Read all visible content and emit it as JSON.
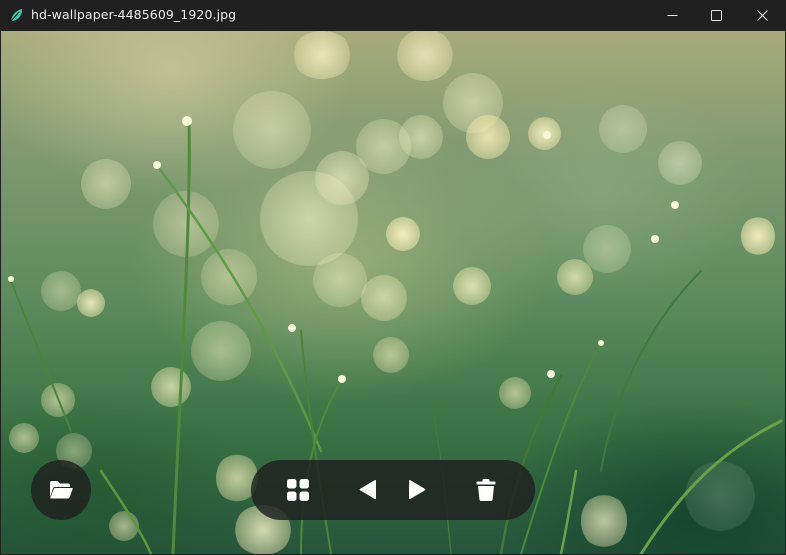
{
  "window": {
    "title": "hd-wallpaper-4485609_1920.jpg",
    "app_icon": "leaf-icon",
    "controls": [
      "minimize-icon",
      "maximize-icon",
      "close-icon"
    ]
  },
  "viewer": {
    "image_description_icon": "photo-icon"
  },
  "toolbar": {
    "open_icon": "folder-open-icon",
    "buttons": [
      "gallery-grid-icon",
      "previous-arrow-icon",
      "next-arrow-icon",
      "trash-icon"
    ]
  },
  "colors": {
    "titlebar": "#202020",
    "title_text": "#ececec",
    "toolbar_bg": "#202020",
    "icon": "#ffffff",
    "app_icon": "#3ddbb8"
  }
}
